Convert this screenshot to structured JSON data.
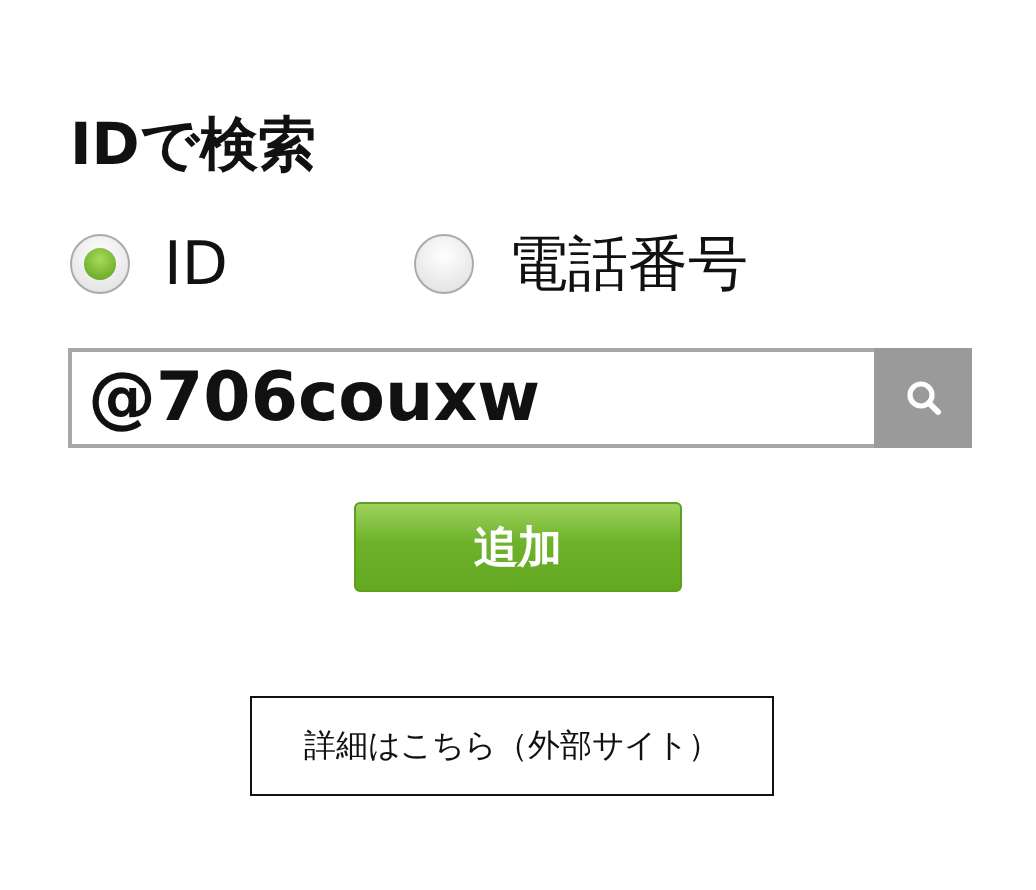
{
  "title": "IDで検索",
  "search_type": [
    {
      "label": "ID",
      "selected": true
    },
    {
      "label": "電話番号",
      "selected": false
    }
  ],
  "search": {
    "value": "@706couxw"
  },
  "add_button": "追加",
  "details_link": "詳細はこちら（外部サイト）"
}
